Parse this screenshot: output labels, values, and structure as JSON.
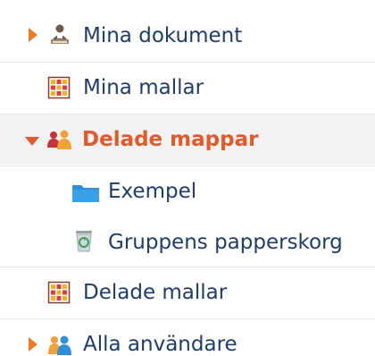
{
  "tree": {
    "items": [
      {
        "label": "Mina dokument",
        "icon": "person-document-icon",
        "expander": "collapsed"
      },
      {
        "label": "Mina mallar",
        "icon": "template-grid-icon",
        "expander": "none"
      },
      {
        "label": "Delade mappar",
        "icon": "shared-group-icon",
        "expander": "expanded",
        "selected": true
      },
      {
        "label": "Exempel",
        "icon": "folder-icon",
        "expander": "none"
      },
      {
        "label": "Gruppens papperskorg",
        "icon": "recycle-bin-icon",
        "expander": "none"
      },
      {
        "label": "Delade mallar",
        "icon": "template-grid-icon",
        "expander": "none"
      },
      {
        "label": "Alla användare",
        "icon": "users-icon",
        "expander": "collapsed"
      }
    ]
  },
  "colors": {
    "link_text": "#1f3d6b",
    "selected_text": "#e2592b",
    "selected_bg": "#f2f2f2",
    "expander": "#f07a1e",
    "folder": "#2f8fd8",
    "divider": "#e6e6e6"
  }
}
